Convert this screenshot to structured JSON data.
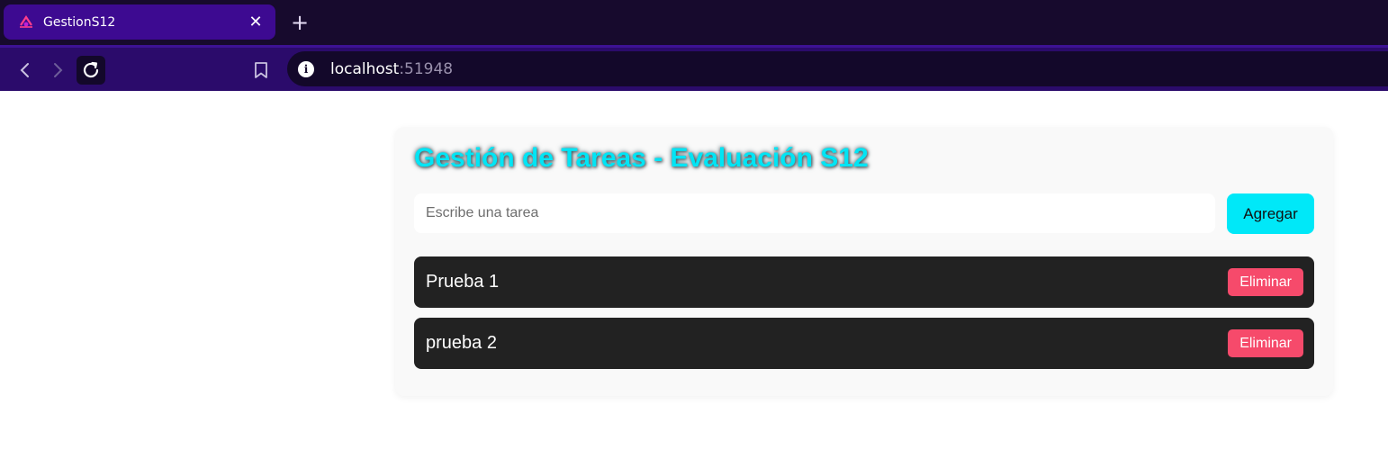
{
  "browser": {
    "tab": {
      "title": "GestionS12",
      "close_label": "✕"
    },
    "new_tab_label": "+",
    "address": {
      "host": "localhost",
      "port": ":51948"
    },
    "colors": {
      "tabstrip": "#170a2d",
      "tab_active": "#3d0a91",
      "toolbar": "#2b0b6b"
    }
  },
  "app": {
    "title": "Gestión de Tareas - Evaluación S12",
    "input": {
      "value": "",
      "placeholder": "Escribe una tarea"
    },
    "add_label": "Agregar",
    "tasks": [
      {
        "text": "Prueba 1",
        "delete_label": "Eliminar"
      },
      {
        "text": "prueba 2",
        "delete_label": "Eliminar"
      }
    ],
    "colors": {
      "accent": "#00e8f8",
      "delete": "#f64a6b",
      "task_bg": "#222222"
    }
  }
}
